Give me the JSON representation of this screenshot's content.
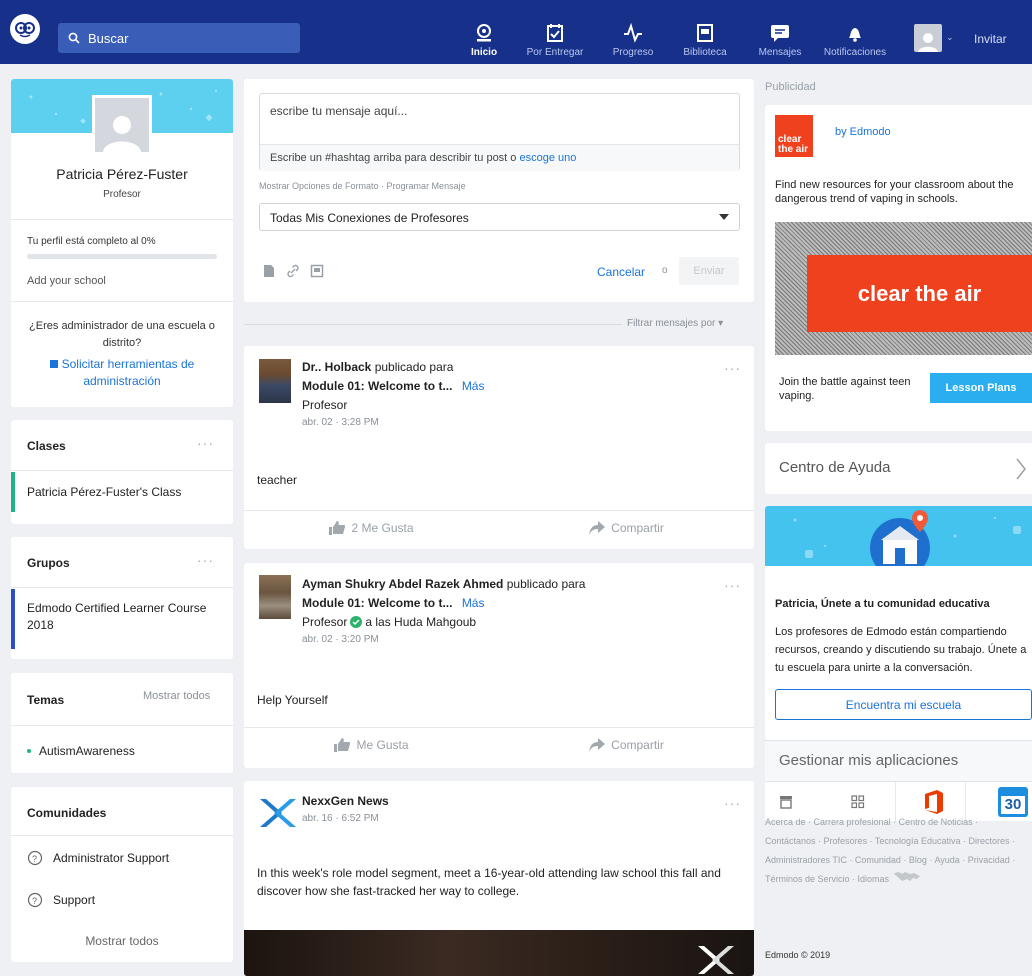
{
  "nav": {
    "search_label": "Buscar",
    "items": [
      "Inicio",
      "Por Entregar",
      "Progreso",
      "Biblioteca",
      "Mensajes",
      "Notificaciones"
    ],
    "invite": "Invitar",
    "accent": "#17308a"
  },
  "profile": {
    "name": "Patricia Pérez-Fuster",
    "role": "Profesor",
    "completion": "Tu perfil está completo al 0%",
    "completion_value": 0,
    "add_school": "Add your school",
    "admin_question": "¿Eres administrador de una escuela o distrito?",
    "admin_link": "Solicitar herramientas de administración"
  },
  "classes": {
    "title": "Clases",
    "items": [
      "Patricia Pérez-Fuster's Class"
    ]
  },
  "groups": {
    "title": "Grupos",
    "items": [
      "Edmodo Certified Learner Course 2018"
    ]
  },
  "topics": {
    "title": "Temas",
    "show_all": "Mostrar todos",
    "items": [
      "AutismAwareness"
    ]
  },
  "communities": {
    "title": "Comunidades",
    "items": [
      "Administrator Support",
      "Support"
    ],
    "show_all": "Mostrar todos"
  },
  "composer": {
    "placeholder": "escribe tu mensaje aquí...",
    "hashtag_text": "Escribe un #hashtag arriba para describir tu post o",
    "hashtag_link": "escoge uno",
    "options": "Mostrar Opciones de Formato",
    "schedule": "Programar Mensaje",
    "audience": "Todas Mis Conexiones de Profesores",
    "cancel": "Cancelar",
    "or": "o",
    "send": "Enviar"
  },
  "filter": "Filtrar mensajes por",
  "posts": [
    {
      "author": "Dr.. Holback",
      "posted_for": "publicado para",
      "target": "Module 01: Welcome to t...",
      "more": "Más",
      "role": "Profesor",
      "date": "abr. 02 · 3:28 PM",
      "body": "teacher",
      "likes": "2 Me Gusta",
      "share": "Compartir"
    },
    {
      "author": "Ayman Shukry Abdel Razek Ahmed",
      "posted_for": "publicado para",
      "target": "Module 01: Welcome to t...",
      "more": "Más",
      "role": "Profesor",
      "to": "a las Huda Mahgoub",
      "date": "abr. 02 · 3:20 PM",
      "body": "Help Yourself",
      "likes": "Me Gusta",
      "share": "Compartir"
    },
    {
      "author": "NexxGen News",
      "date": "abr. 16 · 6:52 PM",
      "body": "In this week's role model segment, meet a 16-year-old attending law school this fall and discover how she fast-tracked her way to college."
    }
  ],
  "ad": {
    "label": "Publicidad",
    "by": "by Edmodo",
    "logo_text": "clear the air",
    "text": "Find new resources for your classroom about the dangerous trend of vaping in schools.",
    "banner": "clear the air",
    "cta_text": "Join the battle against teen vaping.",
    "cta_button": "Lesson Plans"
  },
  "help_center": "Centro de Ayuda",
  "community": {
    "title": "Patricia, Únete a tu comunidad educativa",
    "text": "Los profesores de Edmodo están compartiendo recursos, creando y discutiendo su trabajo. Únete a tu escuela para unirte a la conversación.",
    "button": "Encuentra mi escuela"
  },
  "apps": {
    "title": "Gestionar mis aplicaciones",
    "calendar_day": "30"
  },
  "footer": {
    "links": [
      "Acerca de",
      "Carrera profesional",
      "Centro de Noticias",
      "Contáctanos",
      "Profesores",
      "Tecnología Educativa",
      "Directores",
      "Administradores TIC",
      "Comunidad",
      "Blog",
      "Ayuda",
      "Privacidad",
      "Términos de Servicio",
      "Idiomas"
    ],
    "copyright": "Edmodo © 2019"
  }
}
